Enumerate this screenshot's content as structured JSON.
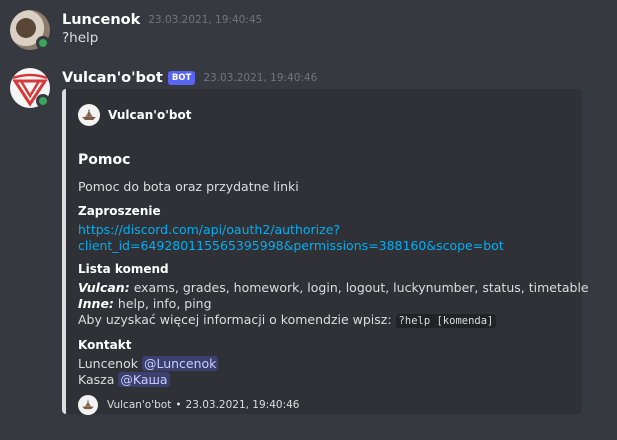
{
  "messages": {
    "user": {
      "username": "Luncenok",
      "timestamp": "23.03.2021, 19:40:45",
      "content": "?help"
    },
    "bot": {
      "username": "Vulcan'o'bot",
      "bot_tag": "BOT",
      "timestamp": "23.03.2021, 19:40:46",
      "embed": {
        "author": "Vulcan'o'bot",
        "title": "Pomoc",
        "description": "Pomoc do bota oraz przydatne linki",
        "invite": {
          "name": "Zaproszenie",
          "link_line1": "https://discord.com/api/oauth2/authorize?",
          "link_line2": "client_id=649280115565395998&permissions=388160&scope=bot"
        },
        "commands": {
          "name": "Lista komend",
          "vulcan_label": "Vulcan:",
          "vulcan_list": "exams, grades, homework, login, logout, luckynumber, status, timetable",
          "other_label": "Inne:",
          "other_list": "help, info, ping",
          "more_info": "Aby uzyskać więcej informacji o komendzie wpisz:",
          "help_code": "?help [komenda]"
        },
        "contact": {
          "name": "Kontakt",
          "person1_name": "Luncenok",
          "person1_mention": "@Luncenok",
          "person2_name": "Kasza",
          "person2_mention": "@Kaшa"
        },
        "footer": {
          "name": "Vulcan'o'bot",
          "separator": "•",
          "timestamp": "23.03.2021, 19:40:46"
        }
      }
    }
  },
  "colors": {
    "background": "#36393f",
    "embed_background": "#2f3136",
    "embed_border": "#dcddde",
    "link": "#00aff4",
    "bot_tag": "#5865f2",
    "online": "#3ba55d",
    "mention": "#c9cdfb"
  }
}
